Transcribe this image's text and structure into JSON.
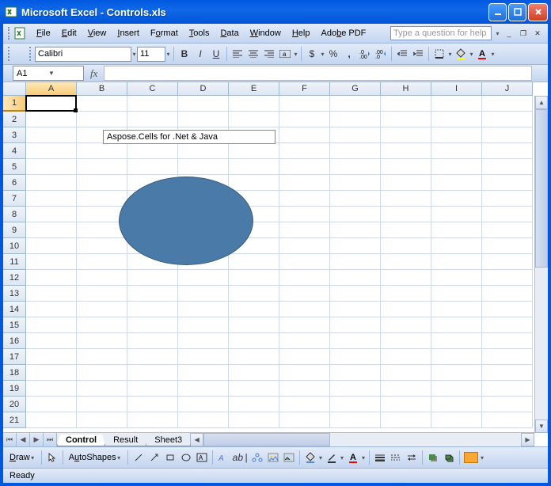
{
  "window": {
    "app": "Microsoft Excel",
    "dash": " - ",
    "doc": "Controls.xls"
  },
  "menu": {
    "file": "File",
    "edit": "Edit",
    "view": "View",
    "insert": "Insert",
    "format": "Format",
    "tools": "Tools",
    "data": "Data",
    "window": "Window",
    "help": "Help",
    "adobe": "Adobe PDF"
  },
  "help_placeholder": "Type a question for help",
  "toolbar": {
    "font": "Calibri",
    "size": "11",
    "currency": "$",
    "percent": "%",
    "comma": ","
  },
  "namebox": "A1",
  "fx": "fx",
  "cols": [
    "A",
    "B",
    "C",
    "D",
    "E",
    "F",
    "G",
    "H",
    "I",
    "J"
  ],
  "rows": [
    "1",
    "2",
    "3",
    "4",
    "5",
    "6",
    "7",
    "8",
    "9",
    "10",
    "11",
    "12",
    "13",
    "14",
    "15",
    "16",
    "17",
    "18",
    "19",
    "20",
    "21"
  ],
  "textbox_value": "Aspose.Cells for .Net  & Java",
  "sheets": {
    "s1": "Control",
    "s2": "Result",
    "s3": "Sheet3"
  },
  "draw": {
    "label": "Draw",
    "autoshapes": "AutoShapes"
  },
  "status": "Ready"
}
